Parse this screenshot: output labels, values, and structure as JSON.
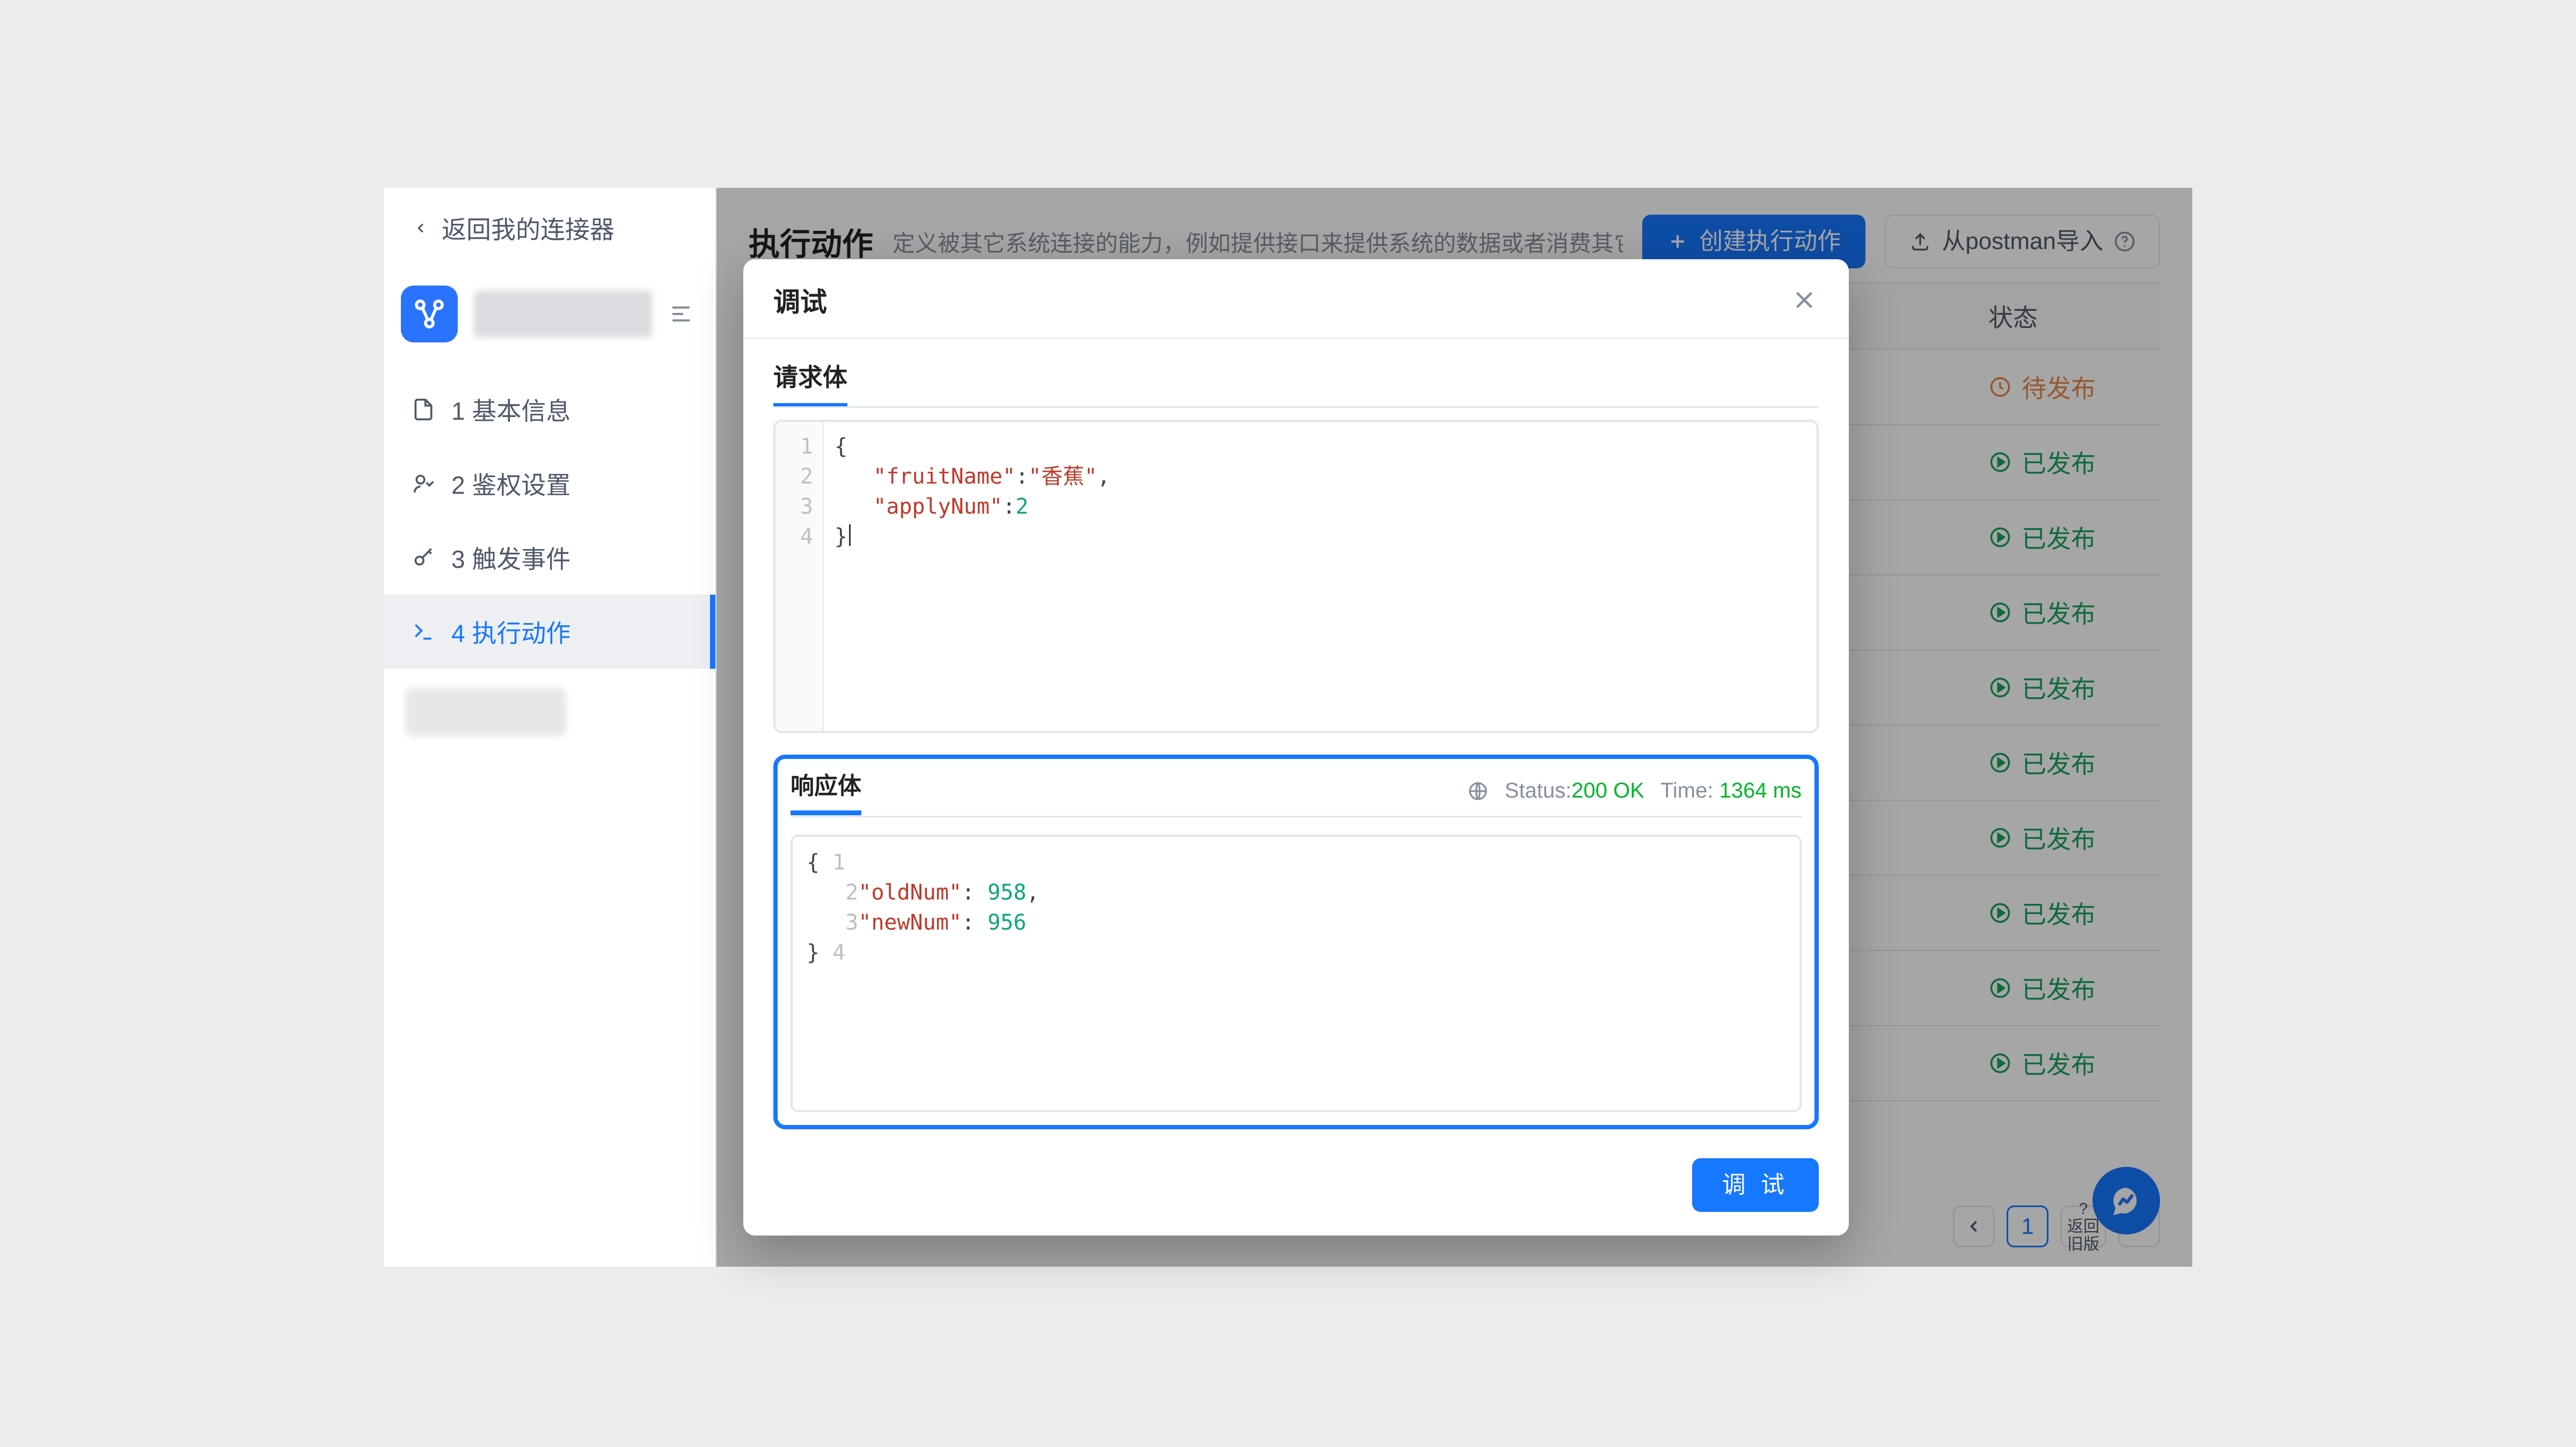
{
  "sidebar": {
    "back_label": "返回我的连接器",
    "items": [
      {
        "label": "1 基本信息"
      },
      {
        "label": "2 鉴权设置"
      },
      {
        "label": "3 触发事件"
      },
      {
        "label": "4 执行动作"
      }
    ]
  },
  "header": {
    "title": "执行动作",
    "desc": "定义被其它系统连接的能力，例如提供接口来提供系统的数据或者消费其它系统推送过来的",
    "create_btn_label": "创建执行动作",
    "import_btn_label": "从postman导入"
  },
  "table": {
    "status_header": "状态",
    "statuses": [
      {
        "type": "pending",
        "label": "待发布"
      },
      {
        "type": "published",
        "label": "已发布"
      },
      {
        "type": "published",
        "label": "已发布"
      },
      {
        "type": "published",
        "label": "已发布"
      },
      {
        "type": "published",
        "label": "已发布"
      },
      {
        "type": "published",
        "label": "已发布"
      },
      {
        "type": "published",
        "label": "已发布"
      },
      {
        "type": "published",
        "label": "已发布"
      },
      {
        "type": "published",
        "label": "已发布"
      },
      {
        "type": "published",
        "label": "已发布"
      }
    ]
  },
  "pagination": {
    "current": "1",
    "unknown": "?",
    "legacy_line1": "返回",
    "legacy_line2": "旧版"
  },
  "modal": {
    "title": "调试",
    "request_label": "请求体",
    "request_body": {
      "keys": {
        "fruitName": "fruitName",
        "applyNum": "applyNum"
      },
      "values": {
        "fruitName_val": "香蕉",
        "applyNum_val": "2"
      },
      "line_numbers": [
        "1",
        "2",
        "3",
        "4"
      ]
    },
    "response_label": "响应体",
    "status": {
      "label": "Status:",
      "value": "200 OK",
      "time_label": "Time:",
      "time_value": "1364 ms"
    },
    "response_body": {
      "keys": {
        "oldNum": "oldNum",
        "newNum": "newNum"
      },
      "values": {
        "oldNum_val": "958",
        "newNum_val": "956"
      },
      "line_numbers": [
        "1",
        "2",
        "3",
        "4"
      ]
    },
    "debug_btn_label": "调 试"
  }
}
